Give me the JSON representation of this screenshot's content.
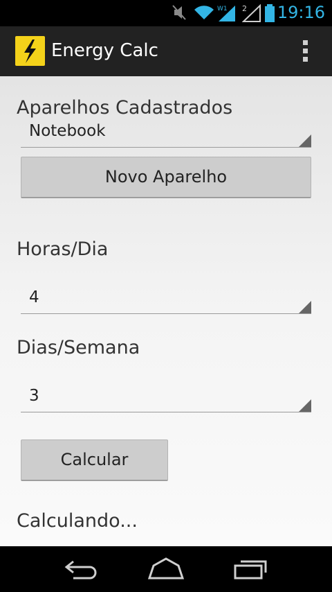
{
  "status_bar": {
    "time": "19:16",
    "icons": [
      "mute-icon",
      "wifi-icon",
      "signal-icon",
      "signal-2-icon",
      "battery-icon"
    ],
    "accent": "#33b5e5"
  },
  "action_bar": {
    "title": "Energy Calc",
    "icon": "lightning-icon",
    "overflow": "overflow-menu-icon",
    "background": "#222222"
  },
  "form": {
    "appliances_label": "Aparelhos Cadastrados",
    "appliance_selected": "Notebook",
    "new_appliance_button": "Novo Aparelho",
    "hours_label": "Horas/Dia",
    "hours_selected": "4",
    "days_label": "Dias/Semana",
    "days_selected": "3",
    "calculate_button": "Calcular",
    "status_text": "Calculando..."
  },
  "nav_bar": {
    "buttons": [
      "back-icon",
      "home-icon",
      "recent-apps-icon"
    ]
  }
}
